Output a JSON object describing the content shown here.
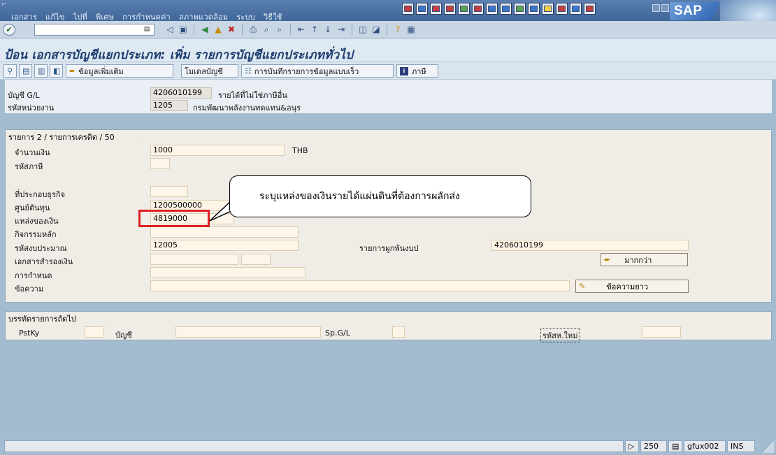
{
  "menu": {
    "items": [
      "เอกสาร",
      "แก้ไข",
      "ไปที่",
      "พิเศษ",
      "การกำหนดค่า",
      "สภาพแวดล้อม",
      "ระบบ",
      "วิธีใช้"
    ]
  },
  "brand": {
    "logo_text": "SAP"
  },
  "command_field": {
    "value": ""
  },
  "title": "ป้อน เอกสารบัญชีแยกประเภท: เพิ่ม รายการบัญชีแยกประเภททั่วไป",
  "app_toolbar": {
    "more_data": "ข้อมูลเพิ่มเติม",
    "account_model": "โมเดลบัญชี",
    "fast_entry": "การบันทึกรายการข้อมูลแบบเร็ว",
    "taxes": "ภาษี"
  },
  "header": {
    "gl_account_label": "บัญชี G/L",
    "gl_account_value": "4206010199",
    "gl_account_desc": "รายได้ที่ไม่ใช่ภาษีอื่น",
    "unit_code_label": "รหัสหน่วยงาน",
    "unit_code_value": "1205",
    "unit_code_desc": "กรมพัฒนาพลังงานทดแทน&อนุร"
  },
  "item_group": {
    "tab_label": "รายการ 2 / รายการเครดิต / 50",
    "amount_label": "จำนวนเงิน",
    "amount_value": "1000",
    "currency": "THB",
    "tax_code_label": "รหัสภาษี",
    "tax_code_value": "",
    "business_area_label": "ที่ประกอบธุรกิจ",
    "business_area_value": "",
    "cost_center_label": "ศูนย์ต้นทุน",
    "cost_center_value": "1200500000",
    "fund_label": "แหล่งของเงิน",
    "fund_value": "4819000",
    "main_activity_label": "กิจกรรมหลัก",
    "main_activity_value": "",
    "budget_code_label": "รหัสงบประมาณ",
    "budget_code_value": "12005",
    "commitment_label": "รายการผูกพันงบป",
    "commitment_value": "4206010199",
    "reserve_doc_label": "เอกสารสำรองเงิน",
    "assignment_label": "การกำหนด",
    "text_label": "ข้อความ",
    "more_button": "มากกว่า",
    "long_text_button": "ข้อความยาว"
  },
  "callout_text": "ระบุแหล่งของเงินรายได้แผ่นดินที่ต้องการผลักส่ง",
  "next_item_group": {
    "tab_label": "บรรทัดรายการถัดไป",
    "pstky_label": "PstKy",
    "account_label": "บัญชี",
    "spgl_label": "Sp.G/L",
    "new_code_label": "รหัสห.ใหม่"
  },
  "status": {
    "count": "250",
    "system": "gfux002",
    "mode": "INS"
  }
}
